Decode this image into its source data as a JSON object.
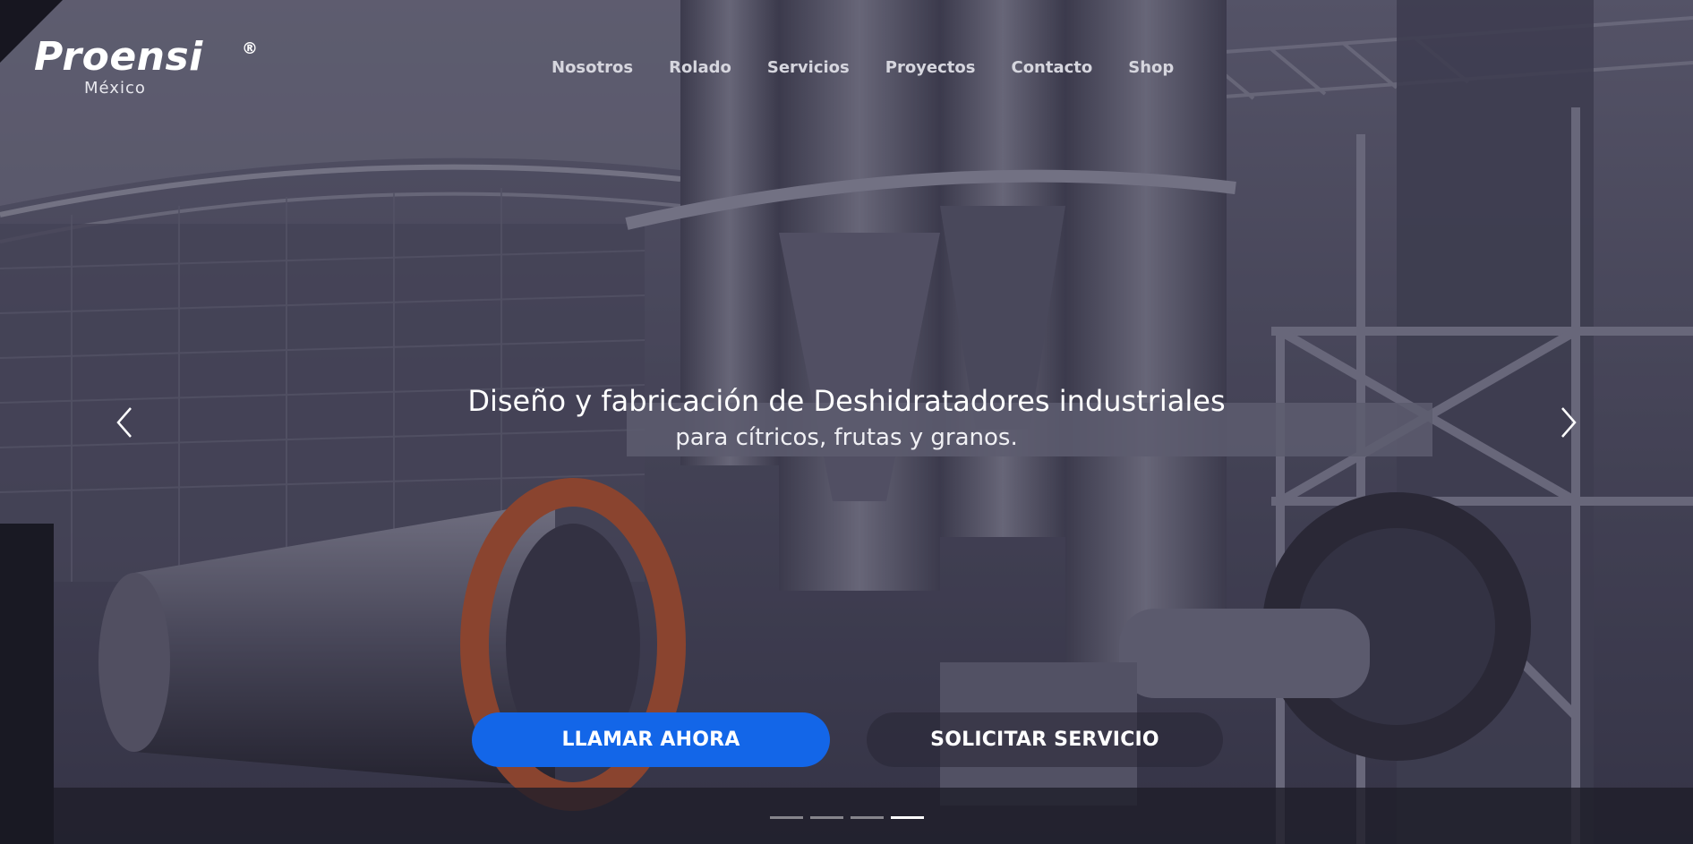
{
  "brand": {
    "name": "Proensi",
    "registered_mark": "®",
    "sub": "México"
  },
  "nav": {
    "items": [
      {
        "label": "Nosotros"
      },
      {
        "label": "Rolado"
      },
      {
        "label": "Servicios"
      },
      {
        "label": "Proyectos"
      },
      {
        "label": "Contacto"
      },
      {
        "label": "Shop"
      }
    ]
  },
  "hero": {
    "headline": "Diseño y fabricación de Deshidratadores industriales",
    "subline": "para cítricos, frutas y granos."
  },
  "cta": {
    "call_label": "LLAMAR AHORA",
    "service_label": "SOLICITAR SERVICIO"
  },
  "carousel": {
    "slides_count": 4,
    "active_slide": 4,
    "prev_icon": "chevron-left-icon",
    "next_icon": "chevron-right-icon"
  },
  "colors": {
    "primary_button": "#1366e8",
    "overlay": "#3d3b50",
    "text": "#ffffff"
  }
}
